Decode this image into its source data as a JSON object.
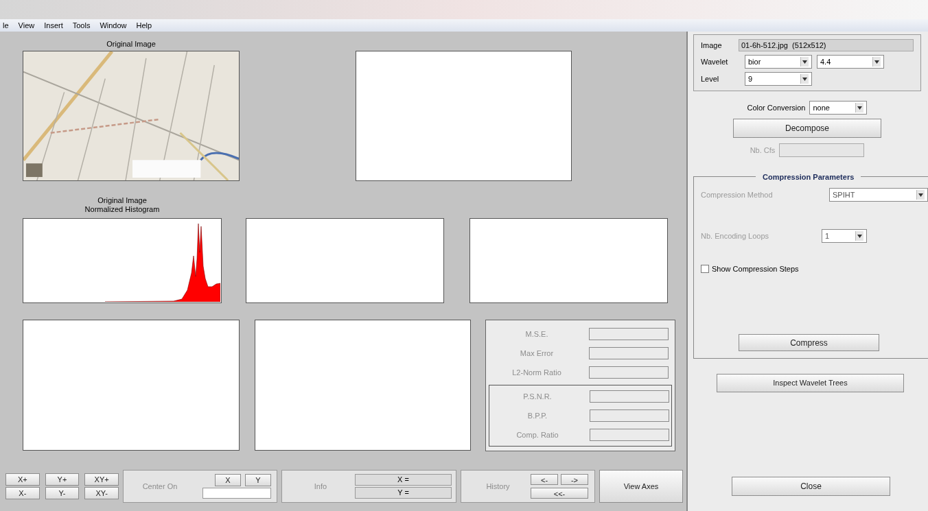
{
  "menu": [
    {
      "label": "le"
    },
    {
      "label": "View"
    },
    {
      "label": "Insert"
    },
    {
      "label": "Tools"
    },
    {
      "label": "Window"
    },
    {
      "label": "Help"
    }
  ],
  "axes": {
    "original_title": "Original Image",
    "histogram_title": [
      "Original Image",
      "Normalized Histogram"
    ]
  },
  "stats": {
    "errors": [
      {
        "label": "M.S.E.",
        "disabled": true
      },
      {
        "label": "Max Error",
        "disabled": true
      },
      {
        "label": "L2-Norm Ratio",
        "disabled": true
      }
    ],
    "ratios": [
      {
        "label": "P.S.N.R.",
        "disabled": true
      },
      {
        "label": "B.P.P.",
        "disabled": true
      },
      {
        "label": "Comp. Ratio",
        "disabled": true
      }
    ]
  },
  "toolbar": {
    "zoom_buttons": [
      "X+",
      "Y+",
      "XY+",
      "X-",
      "Y-",
      "XY-"
    ],
    "center_on": {
      "label": "Center On",
      "buttons": [
        "X",
        "Y"
      ]
    },
    "info": {
      "label": "Info",
      "fields": [
        "X =",
        "Y ="
      ]
    },
    "history": {
      "label": "History",
      "buttons": [
        "<-",
        "->",
        "<<-"
      ]
    },
    "view_axes": "View Axes"
  },
  "panel": {
    "image": {
      "label": "Image",
      "value": "01-6h-512.jpg  (512x512)"
    },
    "wavelet": {
      "label": "Wavelet",
      "family": "bior",
      "order": "4.4"
    },
    "level": {
      "label": "Level",
      "value": "9"
    },
    "color_conversion": {
      "label": "Color Conversion",
      "value": "none"
    },
    "decompose": "Decompose",
    "nb_cfs": {
      "label": "Nb. Cfs",
      "disabled": true
    },
    "compression": {
      "title": "Compression Parameters",
      "method": {
        "label": "Compression Method",
        "value": "SPIHT",
        "disabled": true
      },
      "loops": {
        "label": "Nb. Encoding Loops",
        "value": "1",
        "disabled": true
      },
      "show_steps": {
        "label": "Show Compression Steps",
        "checked": false
      },
      "compress": "Compress"
    },
    "inspect": "Inspect Wavelet Trees",
    "close": "Close"
  }
}
